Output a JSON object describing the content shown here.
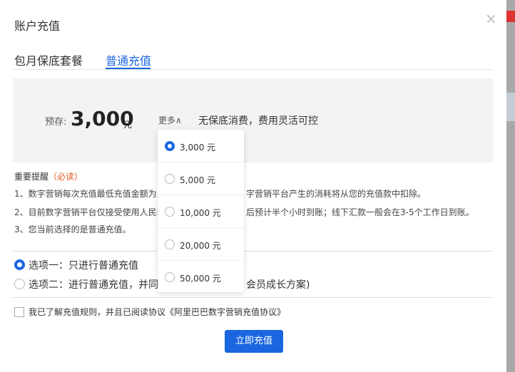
{
  "title": "账户充值",
  "tabs": [
    {
      "label": "包月保底套餐"
    },
    {
      "label": "普通充值"
    }
  ],
  "deposit": {
    "label": "预存:",
    "amount": "3,000",
    "unit": "元",
    "more": "更多∧",
    "slogan": "无保底消费，费用灵活可控"
  },
  "dropdown": [
    {
      "label": "3,000 元",
      "selected": true
    },
    {
      "label": "5,000 元"
    },
    {
      "label": "10,000 元"
    },
    {
      "label": "20,000 元"
    },
    {
      "label": "50,000 元"
    }
  ],
  "notes": {
    "heading": "重要提醒",
    "required": "（必读）",
    "items": [
      "1、数字营销每次充值最低充值金额为人",
      "字营销平台产生的消耗将从您的充值款中扣除。",
      "2、目前数字营销平台仅接受使用人民i",
      "后预计半个小时到账；线下汇款一般会在3-5个工作日到账。",
      "3、您当前选择的是普通充值。"
    ]
  },
  "options": [
    {
      "label": "选项一：只进行普通充值",
      "selected": true
    },
    {
      "label": "选项二：进行普通充值，并同",
      "tail": "会员成长方案)"
    }
  ],
  "agreement": "我已了解充值规则，并且已阅读协议《阿里巴巴数字营销充值协议》",
  "submit": "立即充值",
  "close": "×"
}
